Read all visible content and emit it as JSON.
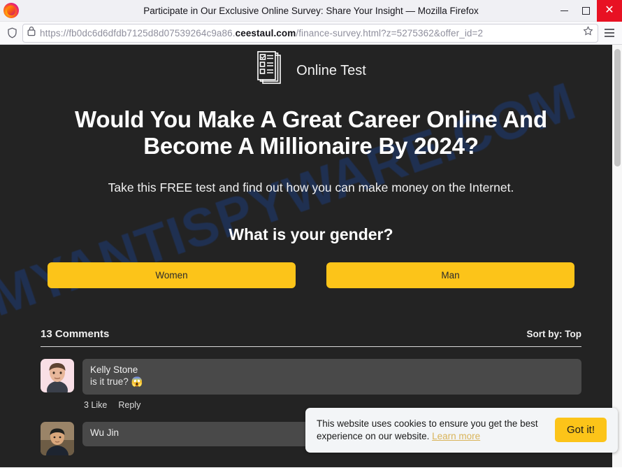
{
  "browser": {
    "window_title": "Participate in Our Exclusive Online Survey: Share Your Insight — Mozilla Firefox",
    "minimize_label": "",
    "maximize_label": "",
    "close_label": "✕",
    "url_prefix": "https://fb0dc6d6dfdb7125d8d07539264c9a86.",
    "url_host": "ceestaul.com",
    "url_path": "/finance-survey.html?z=5275362&offer_id=2"
  },
  "site": {
    "brand_name": "Online Test",
    "watermark": "MYANTISPYWARE.COM",
    "headline": "Would You Make A Great Career Online And Become A Millionaire By 2024?",
    "subhead": "Take this FREE test and find out how you can make money on the Internet.",
    "question": "What is your gender?",
    "choices": [
      {
        "label": "Women"
      },
      {
        "label": "Man"
      }
    ],
    "accent_color": "#fcc419",
    "page_background": "#232323"
  },
  "comments": {
    "count_label": "13 Comments",
    "sort_label": "Sort by: Top",
    "items": [
      {
        "author": "Kelly Stone",
        "text": "is it true? 😱",
        "like_label": "3 Like",
        "reply_label": "Reply"
      },
      {
        "author": "Wu Jin",
        "text": "",
        "like_label": "",
        "reply_label": ""
      }
    ]
  },
  "cookie_banner": {
    "message": "This website uses cookies to ensure you get the best experience on our website.",
    "link_label": "Learn more",
    "button_label": "Got it!"
  }
}
